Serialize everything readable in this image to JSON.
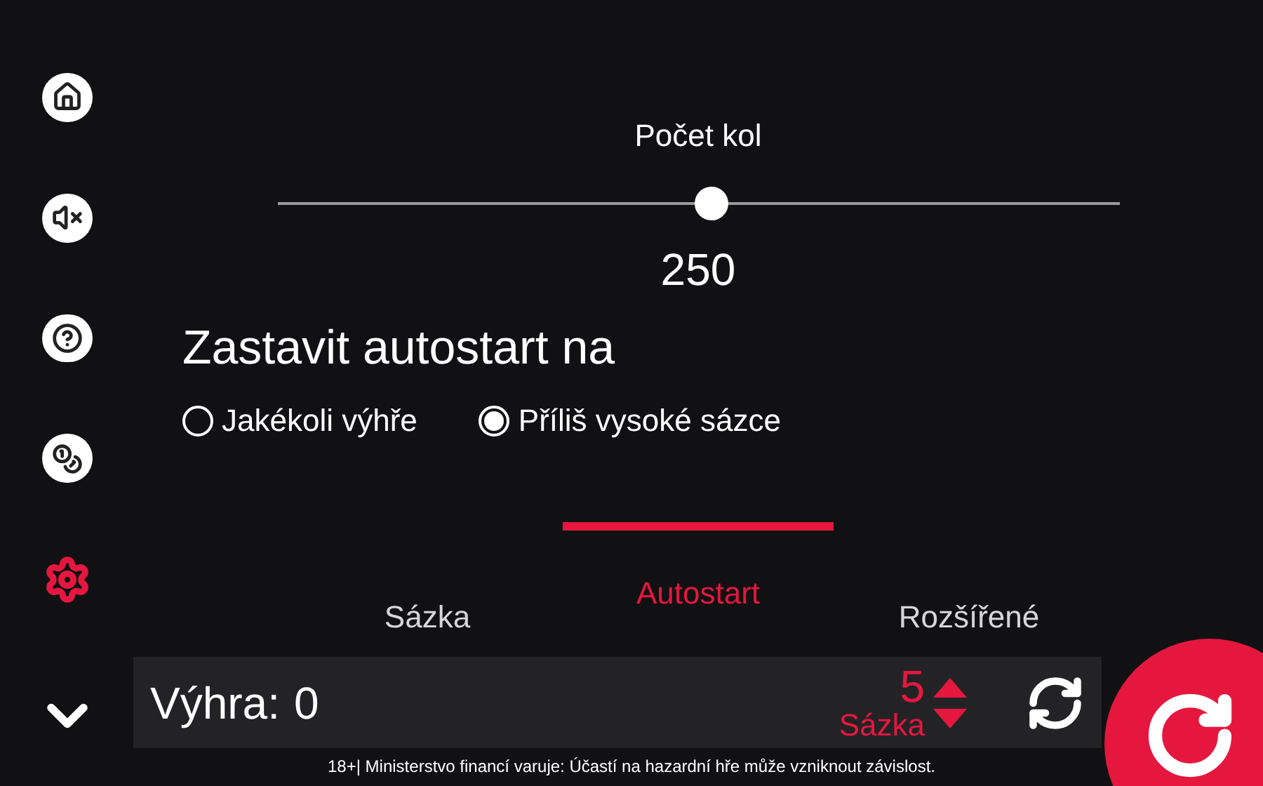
{
  "sidebar": {
    "items": [
      {
        "selected": false
      },
      {
        "selected": false
      },
      {
        "selected": false
      },
      {
        "selected": false
      },
      {
        "selected": true
      }
    ]
  },
  "rounds": {
    "label": "Počet kol",
    "level": 0.515,
    "value": "250"
  },
  "stop": {
    "title": "Zastavit autostart na",
    "options": [
      {
        "label": "Jakékoli výhře",
        "selected": false
      },
      {
        "label": "Příliš vysoké sázce",
        "selected": true
      }
    ]
  },
  "tabs": [
    {
      "label": "Sázka",
      "selected": false
    },
    {
      "label": "Autostart",
      "selected": true
    },
    {
      "label": "Rozšířené",
      "selected": false
    }
  ],
  "bottom_bar": {
    "win_label": "Výhra:",
    "win_value": "0",
    "bet_value": "5",
    "bet_label": "Sázka"
  },
  "footer": "18+| Ministerstvo financí varuje: Účastí na hazardní hře může vzniknout závislost."
}
